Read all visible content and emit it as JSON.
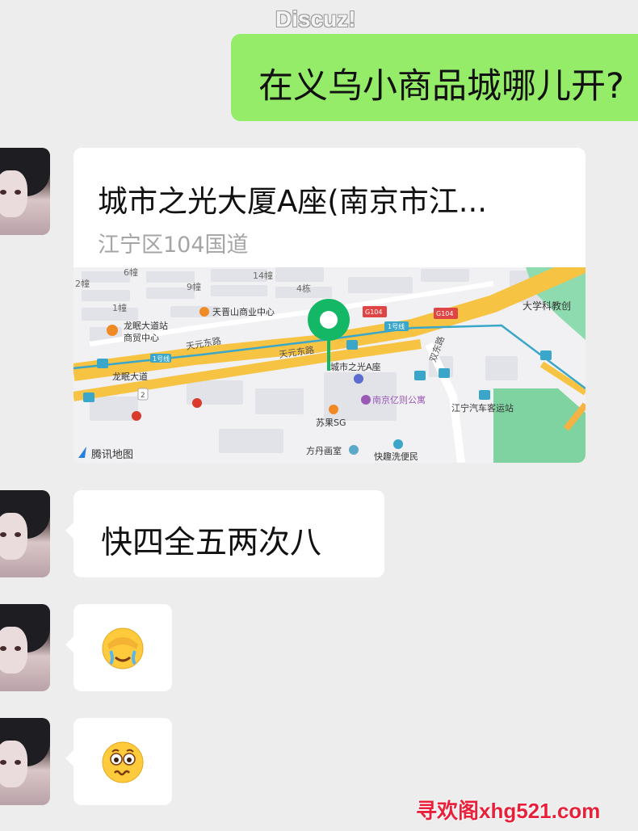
{
  "watermark_top": "Discuz!",
  "watermark_bottom": "寻欢阁xhg521.com",
  "messages": {
    "outgoing_text": "在义乌小商品城哪儿开?",
    "location_title": "城市之光大厦A座(南京市江...",
    "location_address": "江宁区104国道",
    "text_reply": "快四全五两次八",
    "emoji1": "facepalm-crying-emoji",
    "emoji2": "worried-face-emoji"
  },
  "map": {
    "provider": "腾讯地图",
    "labels": {
      "b6": "6幢",
      "b2": "2幢",
      "b9": "9幢",
      "b14": "14幢",
      "b4": "4栋",
      "b1": "1幢",
      "tianyinshan": "天晋山商业中心",
      "longmian_station": "龙眠大道站",
      "shangmao": "商贸中心",
      "tianyuan1": "天元东路",
      "tianyuan2": "天元东路",
      "line1a": "1号线",
      "line1b": "1号线",
      "longmian_ave": "龙眠大道",
      "g104a": "G104",
      "g104b": "G104",
      "pin_label": "城市之光A座",
      "university": "大学科教创",
      "shuangdong": "双东路",
      "yidu": "南京亿则公寓",
      "bus_station": "江宁汽车客运站",
      "suguo": "苏果SG",
      "fangdan": "方丹画室",
      "kuaiqu": "快趣洗便民",
      "num2": "2"
    },
    "colors": {
      "pin": "#13b766",
      "road": "#f6c343",
      "metro": "#3aa6c9",
      "park": "#7ed3a0"
    }
  }
}
